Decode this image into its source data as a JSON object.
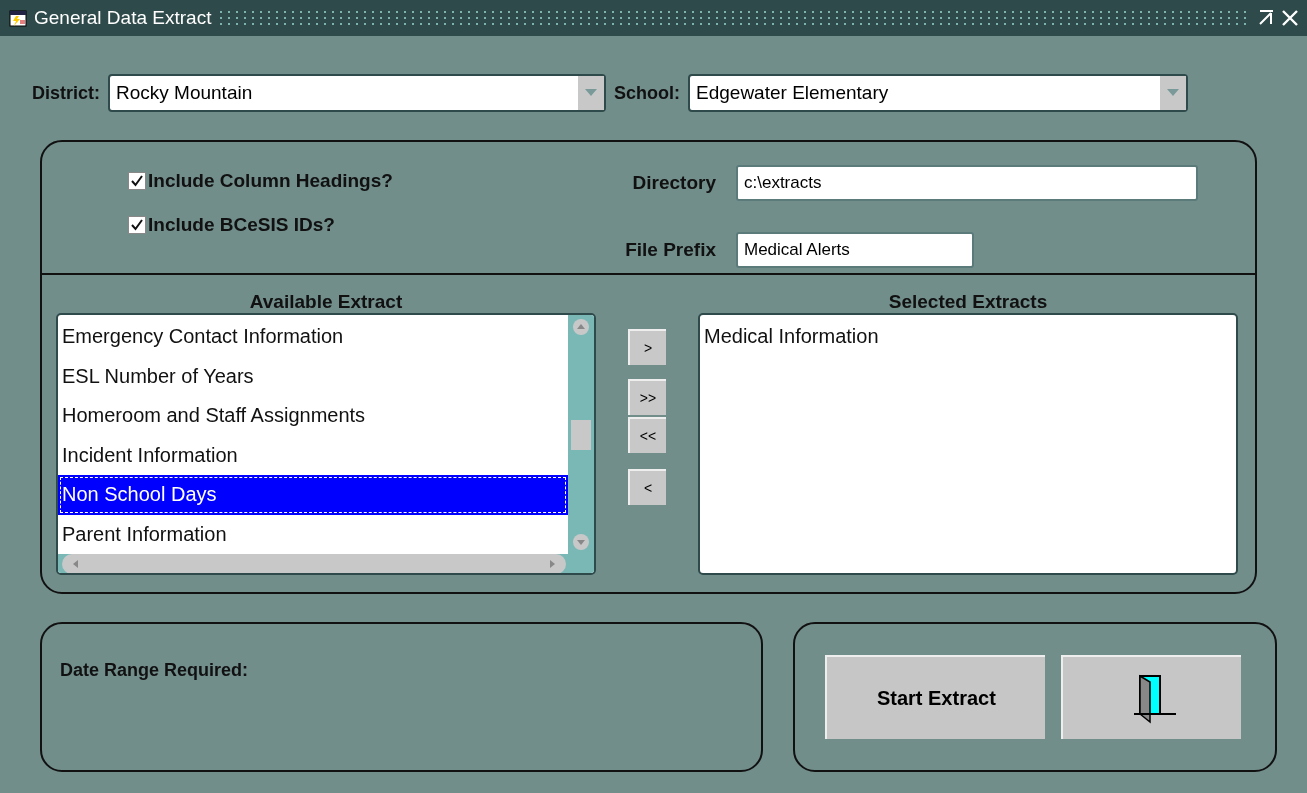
{
  "window": {
    "title": "General Data Extract"
  },
  "district": {
    "label": "District:",
    "value": "Rocky Mountain"
  },
  "school": {
    "label": "School:",
    "value": "Edgewater Elementary"
  },
  "options": [
    {
      "label": "Include Column Headings?",
      "checked": true
    },
    {
      "label": "Include BCeSIS IDs?",
      "checked": true
    }
  ],
  "directory": {
    "label": "Directory",
    "value": "c:\\extracts"
  },
  "file_prefix": {
    "label": "File Prefix",
    "value": "Medical Alerts"
  },
  "available": {
    "title": "Available Extract",
    "items": [
      {
        "label": "Emergency Contact Information",
        "selected": false
      },
      {
        "label": "ESL Number of Years",
        "selected": false
      },
      {
        "label": "Homeroom and Staff Assignments",
        "selected": false
      },
      {
        "label": "Incident Information",
        "selected": false
      },
      {
        "label": "Non School Days",
        "selected": true
      },
      {
        "label": "Parent Information",
        "selected": false
      }
    ]
  },
  "move_buttons": [
    ">",
    ">>",
    "<<",
    "<"
  ],
  "selected_extracts": {
    "title": "Selected Extracts",
    "items": [
      {
        "label": "Medical Information",
        "selected": false
      }
    ]
  },
  "date_range": {
    "label": "Date Range Required:"
  },
  "start_button": "Start Extract"
}
